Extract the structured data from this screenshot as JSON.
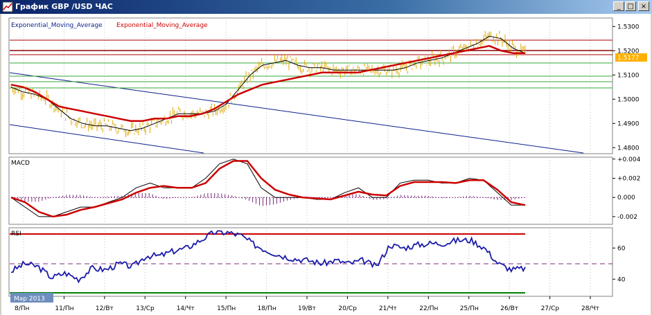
{
  "window": {
    "title": "График GBP /USD  ЧАС",
    "buttons": {
      "minimize": "_",
      "maximize": "□",
      "close": "×"
    }
  },
  "colors": {
    "background": "#ffffff",
    "price_bars": "#e0a800",
    "ema_fast": "#000000",
    "ema_slow": "#cc0000",
    "channel": "#0a1e8c",
    "resistance": "#aa0000",
    "support": "#3aa63a",
    "rsi_line": "#1a1aaa",
    "macd_hist": "#7a2a7a",
    "last_price_tag": "#ffb000"
  },
  "chart_data": [
    {
      "type": "line",
      "title": "",
      "legend": [
        "Exponential_Moving_Average",
        "Exponential_Moving_Average"
      ],
      "y_ticks": [
        "1.5300",
        "1.5200",
        "1.5100",
        "1.5000",
        "1.4900",
        "1.4800"
      ],
      "ylim": [
        1.4775,
        1.5335
      ],
      "last_price": "1.5177",
      "x_labels": [
        "8/Пн",
        "11/Пн",
        "12/Вт",
        "13/Ср",
        "14/Чт",
        "15/Пн",
        "18/Пн",
        "19/Вт",
        "20/Ср",
        "21/Чт",
        "22/Пн",
        "25/Пн",
        "26/Вт",
        "27/Ср",
        "28/Чт"
      ],
      "series": [
        {
          "name": "Exponential_Moving_Average",
          "color": "#000000",
          "values": [
            1.505,
            1.503,
            1.502,
            1.5,
            1.496,
            1.492,
            1.49,
            1.489,
            1.489,
            1.488,
            1.487,
            1.488,
            1.49,
            1.492,
            1.494,
            1.494,
            1.494,
            1.495,
            1.498,
            1.504,
            1.51,
            1.514,
            1.515,
            1.516,
            1.514,
            1.513,
            1.513,
            1.512,
            1.512,
            1.512,
            1.512,
            1.512,
            1.512,
            1.513,
            1.515,
            1.516,
            1.517,
            1.519,
            1.521,
            1.523,
            1.526,
            1.525,
            1.521,
            1.519
          ]
        },
        {
          "name": "Exponential_Moving_Average",
          "color": "#cc0000",
          "values": [
            1.506,
            1.505,
            1.503,
            1.5,
            1.497,
            1.496,
            1.495,
            1.494,
            1.493,
            1.492,
            1.491,
            1.491,
            1.492,
            1.492,
            1.493,
            1.493,
            1.494,
            1.496,
            1.499,
            1.502,
            1.504,
            1.506,
            1.507,
            1.508,
            1.509,
            1.51,
            1.511,
            1.511,
            1.511,
            1.511,
            1.512,
            1.513,
            1.514,
            1.515,
            1.516,
            1.517,
            1.518,
            1.519,
            1.52,
            1.521,
            1.522,
            1.52,
            1.519,
            1.519
          ]
        }
      ]
    },
    {
      "type": "line",
      "title": "MACD",
      "y_ticks": [
        "+0.004",
        "+0.002",
        "0.000",
        "-0.002"
      ],
      "ylim": [
        -0.0028,
        0.0042
      ],
      "series": [
        {
          "name": "",
          "color": "#000000",
          "values": [
            0.0,
            -0.001,
            -0.002,
            -0.002,
            -0.0015,
            -0.001,
            -0.001,
            -0.0005,
            0.0,
            0.001,
            0.0015,
            0.001,
            0.001,
            0.001,
            0.002,
            0.0035,
            0.004,
            0.0035,
            0.001,
            0.0,
            0.0,
            0.0,
            -0.0002,
            -0.0002,
            0.0005,
            0.001,
            0.0,
            0.0,
            0.0015,
            0.0018,
            0.0018,
            0.0015,
            0.0015,
            0.002,
            0.0018,
            0.0005,
            -0.0008,
            -0.0008
          ]
        },
        {
          "name": "",
          "color": "#cc0000",
          "values": [
            0.0,
            -0.0005,
            -0.0015,
            -0.002,
            -0.0018,
            -0.0013,
            -0.001,
            -0.0006,
            -0.0002,
            0.0005,
            0.001,
            0.0012,
            0.001,
            0.001,
            0.0015,
            0.003,
            0.0038,
            0.0038,
            0.002,
            0.0008,
            0.0003,
            0.0,
            -0.0001,
            -0.0002,
            0.0002,
            0.0006,
            0.0003,
            0.0002,
            0.0012,
            0.0016,
            0.0016,
            0.0016,
            0.0015,
            0.0018,
            0.0018,
            0.0008,
            -0.0005,
            -0.0008
          ]
        }
      ]
    },
    {
      "type": "line",
      "title": "RSI",
      "y_ticks": [
        "60",
        "40"
      ],
      "ylim": [
        29,
        73
      ],
      "series": [
        {
          "name": "",
          "color": "#1a1aaa",
          "values": [
            45,
            50,
            48,
            41,
            44,
            40,
            47,
            46,
            50,
            48,
            55,
            55,
            58,
            60,
            65,
            70,
            70,
            68,
            62,
            58,
            55,
            53,
            52,
            50,
            52,
            50,
            52,
            48,
            62,
            60,
            62,
            63,
            63,
            65,
            65,
            60,
            50,
            46,
            47
          ]
        }
      ]
    }
  ],
  "badge": {
    "text": "Мар 2013"
  }
}
